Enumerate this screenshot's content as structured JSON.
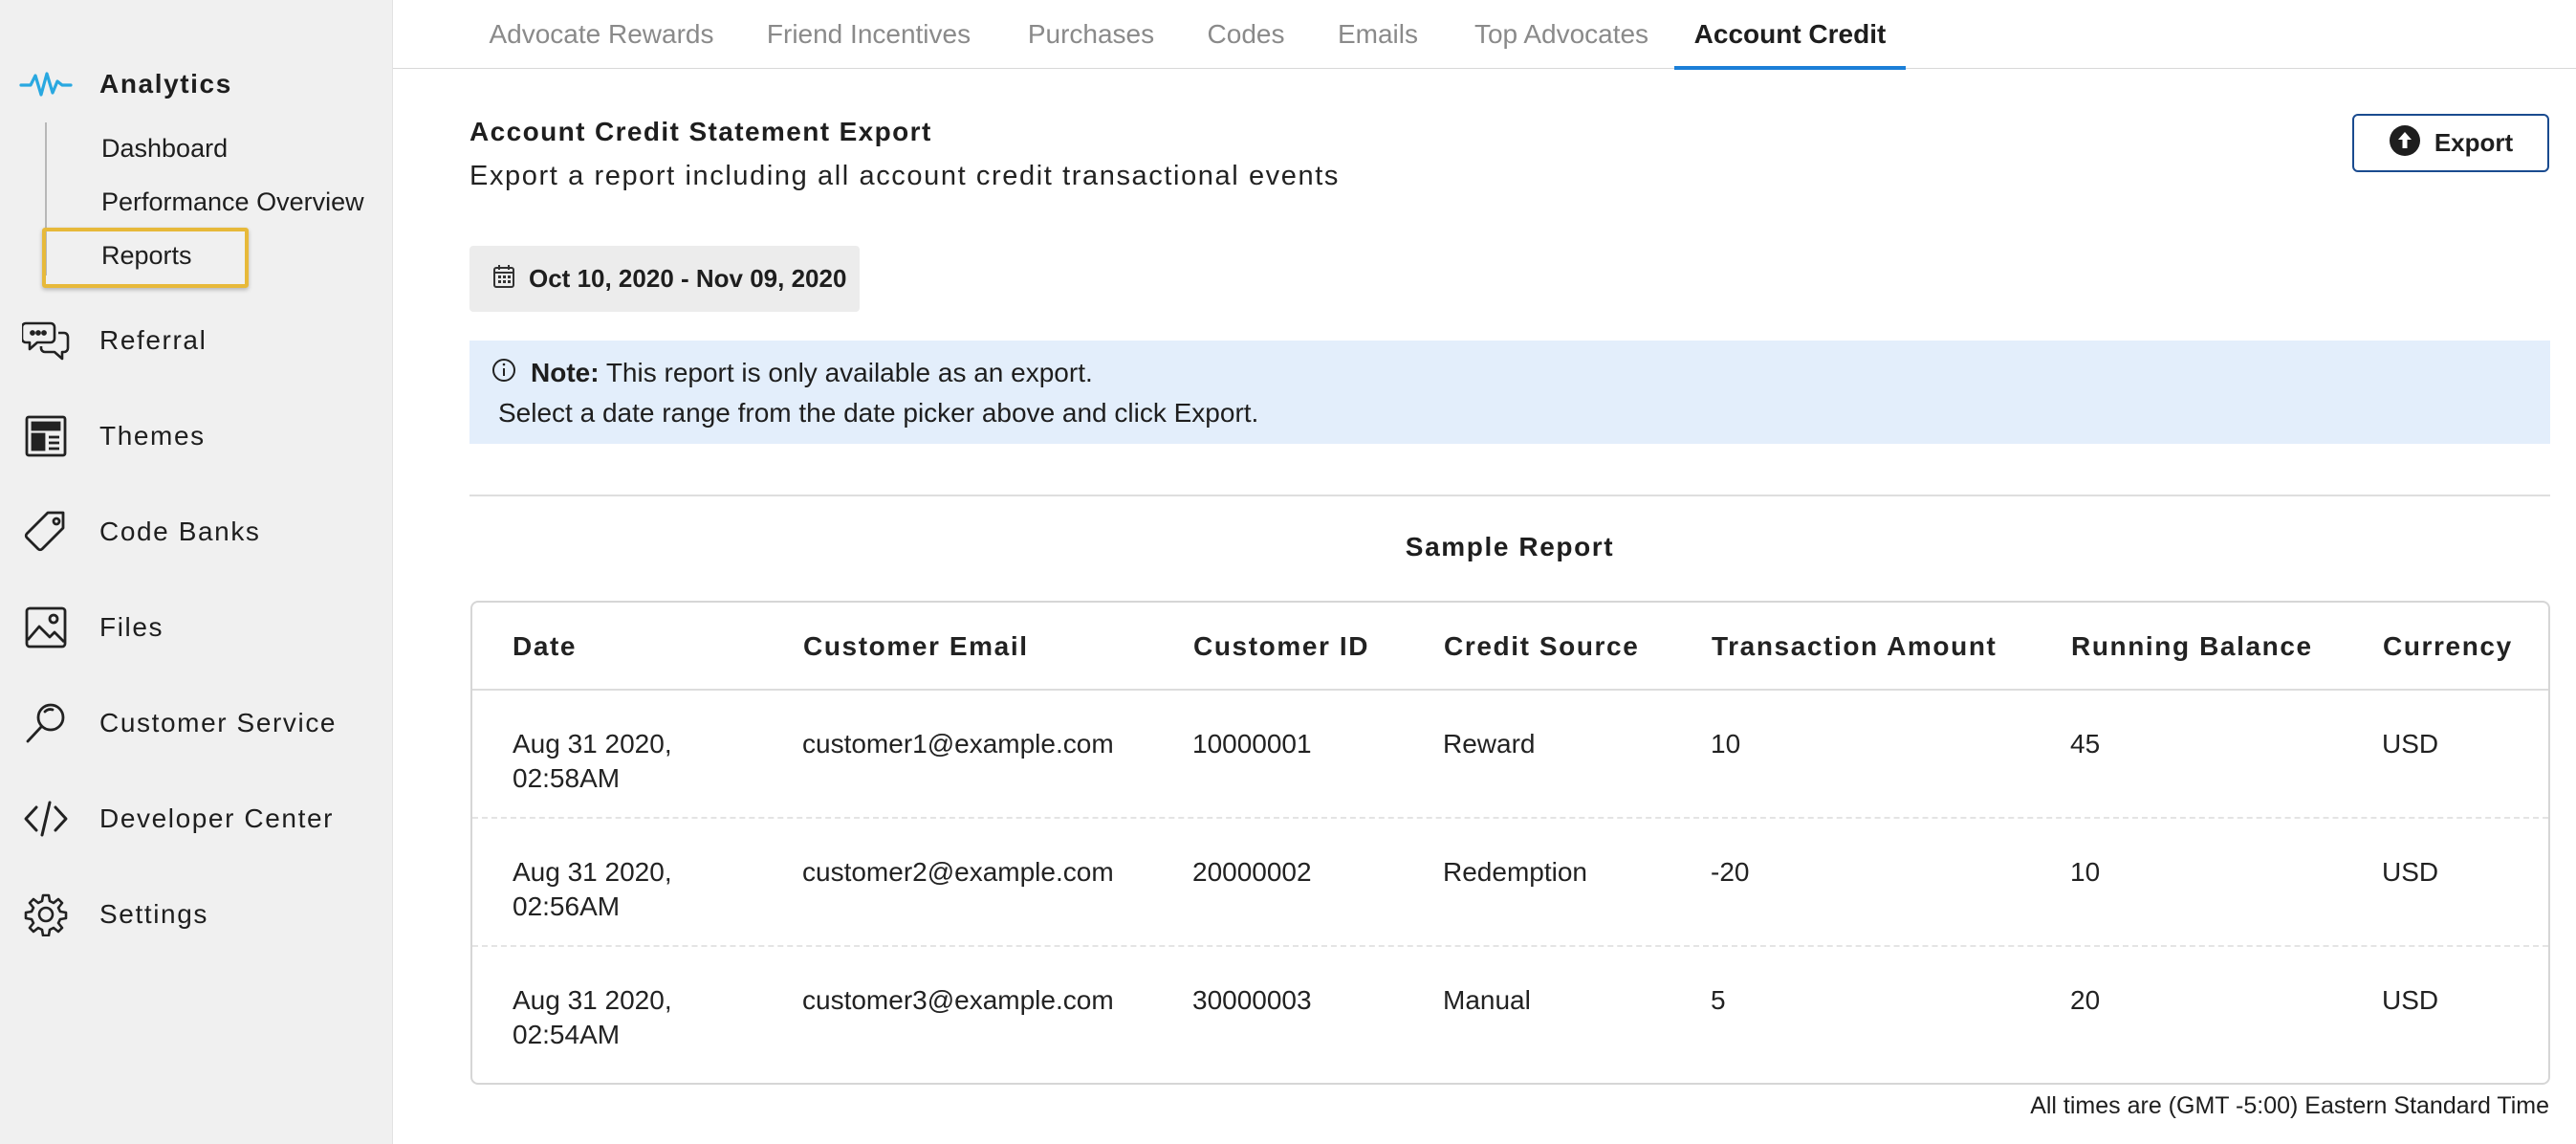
{
  "sidebar": {
    "analytics": {
      "label": "Analytics",
      "icon": "analytics-icon"
    },
    "sub_items": [
      "Dashboard",
      "Performance Overview",
      "Reports"
    ],
    "items": [
      {
        "label": "Referral",
        "icon": "chat-bubbles-icon"
      },
      {
        "label": "Themes",
        "icon": "layout-icon"
      },
      {
        "label": "Code Banks",
        "icon": "tag-icon"
      },
      {
        "label": "Files",
        "icon": "image-icon"
      },
      {
        "label": "Customer Service",
        "icon": "magnifier-icon"
      },
      {
        "label": "Developer Center",
        "icon": "code-icon"
      },
      {
        "label": "Settings",
        "icon": "gear-icon"
      }
    ]
  },
  "tabs": [
    "Advocate Rewards",
    "Friend Incentives",
    "Purchases",
    "Codes",
    "Emails",
    "Top Advocates",
    "Account Credit"
  ],
  "active_tab": "Account Credit",
  "header": {
    "title": "Account Credit Statement Export",
    "description": "Export a report including all account credit transactional events",
    "export_label": "Export"
  },
  "date_range": "Oct 10, 2020 - Nov 09, 2020",
  "note": {
    "bold": "Note:",
    "text": "This report is only available as an export.",
    "line2": "Select a date range from the date picker above and click Export."
  },
  "sample_title": "Sample Report",
  "table": {
    "columns": [
      "Date",
      "Customer Email",
      "Customer ID",
      "Credit Source",
      "Transaction Amount",
      "Running Balance",
      "Currency"
    ],
    "rows": [
      [
        "Aug 31 2020, 02:58AM",
        "customer1@example.com",
        "10000001",
        "Reward",
        "10",
        "45",
        "USD"
      ],
      [
        "Aug 31 2020, 02:56AM",
        "customer2@example.com",
        "20000002",
        "Redemption",
        "-20",
        "10",
        "USD"
      ],
      [
        "Aug 31 2020, 02:54AM",
        "customer3@example.com",
        "30000003",
        "Manual",
        "5",
        "20",
        "USD"
      ]
    ]
  },
  "footer_note": "All times are (GMT -5:00) Eastern Standard Time",
  "colors": {
    "accent": "#1b7fd8",
    "analytics_icon": "#29a8e0",
    "highlight_box": "#e7b93a",
    "note_bg": "#e3eefb",
    "export_border": "#1a4b8f"
  }
}
